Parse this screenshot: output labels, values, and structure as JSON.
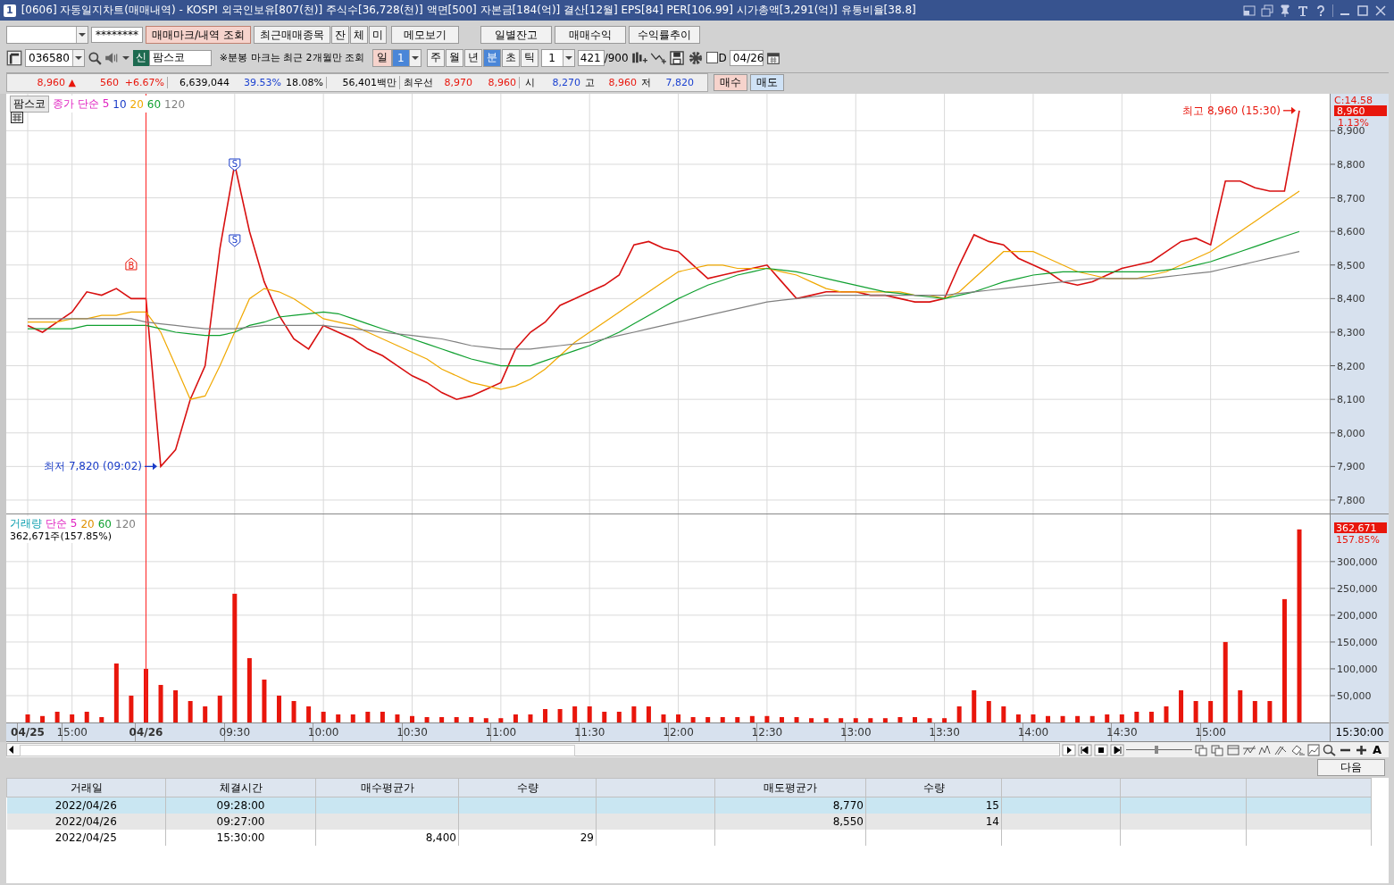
{
  "window": {
    "number": "1",
    "title": "[0606] 자동일지차트(매매내역) - KOSPI 외국인보유[807(천)] 주식수[36,728(천)] 액면[500] 자본금[184(억)] 결산[12월] EPS[84] PER[106.99] 시가총액[3,291(억)] 유통비율[38.8]"
  },
  "toolbar": {
    "password": "********",
    "buttons": [
      {
        "label": "매매마크/내역 조회",
        "selected": true
      },
      {
        "label": "최근매매종목",
        "selected": false
      },
      {
        "label": "잔",
        "selected": false
      },
      {
        "label": "체",
        "selected": false
      },
      {
        "label": "미",
        "selected": false
      },
      {
        "label": "메모보기",
        "selected": false
      }
    ],
    "right_buttons": [
      "일별잔고",
      "매매수익",
      "수익률추이"
    ]
  },
  "symbol_bar": {
    "code": "036580",
    "badge": "신",
    "name": "팜스코",
    "note": "※분봉 마크는 최근 2개월만 조회",
    "day_button": "일",
    "day_count": "1",
    "periods": [
      {
        "label": "주",
        "selected": false
      },
      {
        "label": "월",
        "selected": false
      },
      {
        "label": "년",
        "selected": false
      },
      {
        "label": "분",
        "selected": true
      },
      {
        "label": "초",
        "selected": false
      },
      {
        "label": "틱",
        "selected": false
      }
    ],
    "interval": "1",
    "count": "421",
    "max": "/900",
    "d_checkbox": {
      "label": "D",
      "checked": false
    },
    "date": "04/26"
  },
  "quote_bar": {
    "items": [
      {
        "text": "8,960 ▲",
        "color": "#e8160c"
      },
      {
        "text": "560",
        "color": "#e8160c"
      },
      {
        "text": "+6.67%",
        "color": "#e8160c"
      },
      {
        "text": "6,639,044"
      },
      {
        "text": "39.53%",
        "color": "#1a40d0"
      },
      {
        "text": "18.08%"
      },
      {
        "text": "56,401백만"
      },
      {
        "text": "최우선"
      },
      {
        "text": "8,970",
        "color": "#e8160c"
      },
      {
        "text": "8,960",
        "color": "#e8160c"
      },
      {
        "text": "시"
      },
      {
        "text": "8,270",
        "color": "#1a40d0"
      },
      {
        "text": "고"
      },
      {
        "text": "8,960",
        "color": "#e8160c"
      },
      {
        "text": "저"
      },
      {
        "text": "7,820",
        "color": "#1a40d0"
      }
    ],
    "buy_button": "매수",
    "sell_button": "매도"
  },
  "price_chart": {
    "symbol_button": "팜스코",
    "legend": [
      {
        "text": "종가 단순 5",
        "color": "#e020c0"
      },
      {
        "text": "10",
        "color": "#1a3cc8"
      }
    ],
    "axis_header": {
      "cursor": "C:14.58",
      "price": "8,960",
      "change": "1.13%"
    },
    "chart_data": {
      "type": "line",
      "grid": true,
      "series": [
        {
          "color": "#d81010",
          "values": [
            8320,
            8300,
            8330,
            8360,
            8420,
            8410,
            8430,
            8400,
            8400,
            7900,
            7950,
            8100,
            8200,
            8550,
            8800,
            8600,
            8450,
            8350,
            8280,
            8250,
            8320,
            8300,
            8280,
            8250,
            8230,
            8200,
            8170,
            8150,
            8120,
            8100,
            8110,
            8130,
            8150,
            8250,
            8300,
            8330,
            8380,
            8400,
            8420,
            8440,
            8470,
            8560,
            8570,
            8550,
            8540,
            8500,
            8460,
            8470,
            8480,
            8490,
            8500,
            8450,
            8400,
            8410,
            8420,
            8420,
            8420,
            8410,
            8410,
            8400,
            8390,
            8390,
            8400,
            8500,
            8590,
            8570,
            8560,
            8520,
            8500,
            8480,
            8450,
            8440,
            8450,
            8470,
            8490,
            8500,
            8510,
            8540,
            8570,
            8580,
            8560,
            8750,
            8750,
            8730,
            8720,
            8720,
            8960
          ]
        },
        {
          "name": "20",
          "color": "#f0a800",
          "values": [
            8330,
            8330,
            8330,
            8340,
            8340,
            8350,
            8350,
            8360,
            8360,
            8300,
            8200,
            8100,
            8110,
            8200,
            8300,
            8400,
            8430,
            8420,
            8400,
            8370,
            8340,
            8330,
            8320,
            8300,
            8280,
            8260,
            8240,
            8220,
            8190,
            8170,
            8150,
            8140,
            8130,
            8140,
            8160,
            8190,
            8230,
            8270,
            8300,
            8330,
            8360,
            8390,
            8420,
            8450,
            8480,
            8490,
            8500,
            8500,
            8490,
            8490,
            8490,
            8480,
            8470,
            8450,
            8430,
            8420,
            8420,
            8420,
            8420,
            8420,
            8410,
            8410,
            8400,
            8420,
            8460,
            8500,
            8540,
            8540,
            8540,
            8520,
            8500,
            8480,
            8470,
            8460,
            8460,
            8460,
            8470,
            8480,
            8500,
            8520,
            8540,
            8570,
            8600,
            8630,
            8660,
            8690,
            8720
          ]
        },
        {
          "name": "60",
          "color": "#10a030",
          "values": [
            8310,
            8310,
            8310,
            8310,
            8320,
            8320,
            8320,
            8320,
            8320,
            8310,
            8300,
            8295,
            8290,
            8290,
            8300,
            8320,
            8330,
            8345,
            8350,
            8355,
            8360,
            8355,
            8340,
            8325,
            8310,
            8295,
            8280,
            8265,
            8250,
            8235,
            8220,
            8210,
            8200,
            8200,
            8200,
            8215,
            8230,
            8245,
            8260,
            8280,
            8300,
            8325,
            8350,
            8375,
            8400,
            8420,
            8440,
            8455,
            8470,
            8480,
            8490,
            8485,
            8480,
            8470,
            8460,
            8450,
            8440,
            8430,
            8420,
            8415,
            8410,
            8405,
            8400,
            8410,
            8420,
            8435,
            8450,
            8460,
            8470,
            8475,
            8480,
            8480,
            8480,
            8480,
            8480,
            8480,
            8480,
            8485,
            8490,
            8500,
            8510,
            8525,
            8540,
            8555,
            8570,
            8585,
            8600
          ]
        },
        {
          "name": "120",
          "color": "#808080",
          "values": [
            8340,
            8340,
            8340,
            8340,
            8340,
            8340,
            8340,
            8340,
            8330,
            8325,
            8320,
            8315,
            8310,
            8310,
            8310,
            8315,
            8320,
            8320,
            8320,
            8320,
            8320,
            8315,
            8310,
            8305,
            8300,
            8295,
            8290,
            8285,
            8280,
            8270,
            8260,
            8255,
            8250,
            8250,
            8250,
            8255,
            8260,
            8265,
            8270,
            8280,
            8290,
            8300,
            8310,
            8320,
            8330,
            8340,
            8350,
            8360,
            8370,
            8380,
            8390,
            8395,
            8400,
            8405,
            8410,
            8410,
            8410,
            8410,
            8410,
            8410,
            8410,
            8410,
            8410,
            8415,
            8420,
            8425,
            8430,
            8435,
            8440,
            8445,
            8450,
            8455,
            8460,
            8460,
            8460,
            8460,
            8460,
            8465,
            8470,
            8475,
            8480,
            8490,
            8500,
            8510,
            8520,
            8530,
            8540
          ]
        }
      ],
      "ylim": [
        7760,
        9010
      ],
      "yticks": [
        {
          "value": 7800,
          "label": "7,800"
        },
        {
          "value": 7900,
          "label": "7,900"
        },
        {
          "value": 8000,
          "label": "8,000"
        },
        {
          "value": 8100,
          "label": "8,100"
        },
        {
          "value": 8200,
          "label": "8,200"
        },
        {
          "value": 8300,
          "label": "8,300"
        },
        {
          "value": 8400,
          "label": "8,400"
        },
        {
          "value": 8500,
          "label": "8,500"
        },
        {
          "value": 8600,
          "label": "8,600"
        },
        {
          "value": 8700,
          "label": "8,700"
        },
        {
          "value": 8800,
          "label": "8,800"
        },
        {
          "value": 8900,
          "label": "8,900"
        }
      ],
      "annotations": [
        "최고 8,960 (15:30)",
        "최저 7,820 (09:02)",
        "S",
        "S",
        "B"
      ]
    }
  },
  "volume_chart": {
    "legend": [
      {
        "text": "단순 5",
        "color": "#e020c0"
      }
    ],
    "reading": "362,671주(157.85%)",
    "axis_header": {
      "value": "362,671",
      "change": "157.85%"
    },
    "chart_data": {
      "type": "bar",
      "grid": true,
      "categories": [
        "04/25",
        null,
        null,
        "15:00",
        null,
        null,
        null,
        null,
        "04/26",
        null,
        null,
        null,
        null,
        null,
        "09:30",
        null,
        null,
        null,
        null,
        null,
        "10:00",
        null,
        null,
        null,
        null,
        null,
        "10:30",
        null,
        null,
        null,
        null,
        null,
        "11:00",
        null,
        null,
        null,
        null,
        null,
        "11:30",
        null,
        null,
        null,
        null,
        null,
        "12:00",
        null,
        null,
        null,
        null,
        null,
        "12:30",
        null,
        null,
        null,
        null,
        null,
        "13:00",
        null,
        null,
        null,
        null,
        null,
        "13:30",
        null,
        null,
        null,
        null,
        null,
        "14:00",
        null,
        null,
        null,
        null,
        null,
        "14:30",
        null,
        null,
        null,
        null,
        null,
        "15:00",
        null,
        null,
        null,
        null,
        null,
        null
      ],
      "series": [
        {
          "name": "거래량",
          "color": "#e8160c",
          "values": [
            15000,
            12000,
            20000,
            15000,
            20000,
            10000,
            110000,
            50000,
            100000,
            70000,
            60000,
            40000,
            30000,
            50000,
            240000,
            120000,
            80000,
            50000,
            40000,
            30000,
            20000,
            15000,
            15000,
            20000,
            20000,
            15000,
            12000,
            10000,
            10000,
            10000,
            10000,
            8000,
            8000,
            15000,
            15000,
            25000,
            25000,
            30000,
            30000,
            20000,
            20000,
            30000,
            30000,
            15000,
            15000,
            10000,
            10000,
            10000,
            10000,
            12000,
            12000,
            10000,
            10000,
            8000,
            8000,
            8000,
            8000,
            8000,
            8000,
            10000,
            10000,
            8000,
            8000,
            30000,
            60000,
            40000,
            30000,
            15000,
            15000,
            12000,
            12000,
            12000,
            12000,
            15000,
            15000,
            20000,
            20000,
            30000,
            60000,
            40000,
            40000,
            150000,
            60000,
            40000,
            40000,
            230000,
            360000
          ]
        }
      ],
      "ylim": [
        0,
        388000
      ],
      "yticks": [
        {
          "value": 50000,
          "label": "50,000"
        },
        {
          "value": 100000,
          "label": "100,000"
        },
        {
          "value": 150000,
          "label": "150,000"
        },
        {
          "value": 200000,
          "label": "200,000"
        },
        {
          "value": 250000,
          "label": "250,000"
        },
        {
          "value": 300000,
          "label": "300,000"
        }
      ],
      "ref_lines": [
        {
          "axis": "x",
          "value": "04/26",
          "color": "#ff2020"
        }
      ]
    }
  },
  "volume_legend_tail": [
    {
      "text": "20",
      "color": "#e09000"
    },
    {
      "text": "60",
      "color": "#10a030"
    },
    {
      "text": "120",
      "color": "#808080"
    }
  ],
  "time_axis_end": "15:30:00",
  "chart_tools": {
    "zoom": {
      "level": 0.45
    },
    "font_button": "A"
  },
  "next_button": "다음",
  "table": {
    "columns": [
      "거래일",
      "체결시간",
      "매수평균가",
      "수량",
      "매도평균가",
      "수량"
    ],
    "rows": [
      {
        "selected": true,
        "cells": [
          "2022/04/26",
          "09:28:00",
          null,
          null,
          "8,770",
          "15"
        ]
      },
      {
        "selected": false,
        "cells": [
          "2022/04/26",
          "09:27:00",
          null,
          null,
          "8,550",
          "14"
        ]
      },
      {
        "selected": false,
        "cells": [
          "2022/04/25",
          "15:30:00",
          "8,400",
          "29",
          null,
          null
        ]
      }
    ]
  }
}
